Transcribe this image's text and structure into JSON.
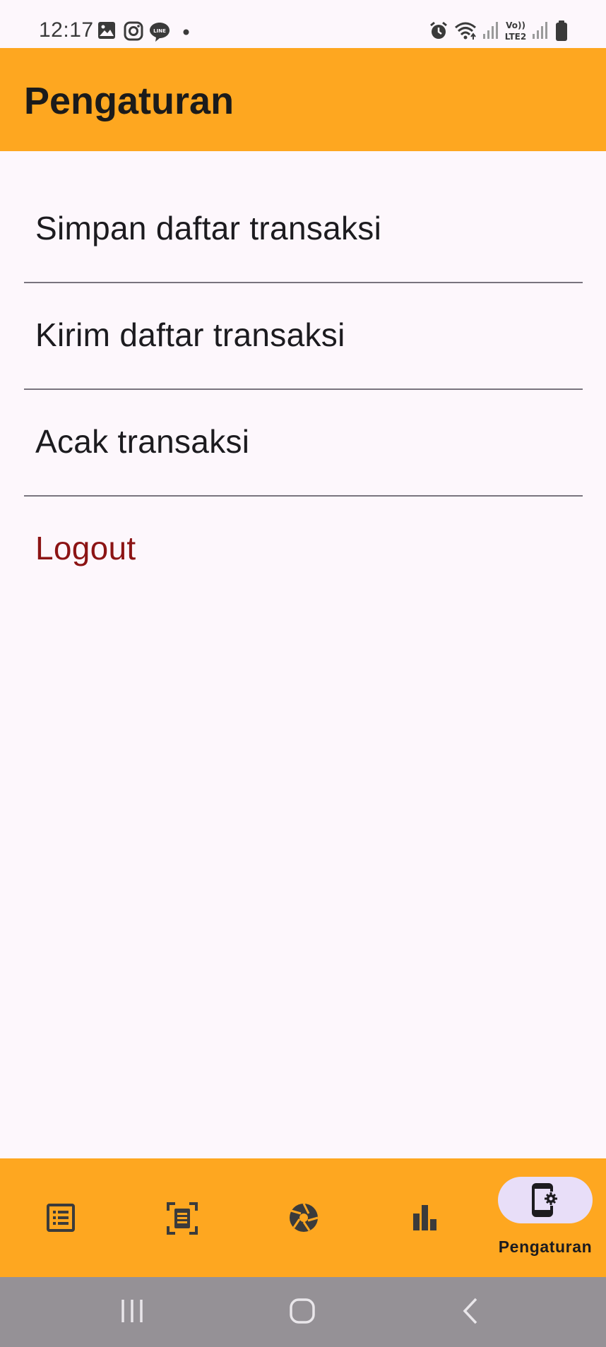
{
  "status_bar": {
    "time": "12:17",
    "left_icons": [
      "gallery-icon",
      "instagram-icon",
      "line-icon",
      "dot-icon"
    ],
    "right_icons": [
      "alarm-icon",
      "wifi-icon",
      "signal-icon",
      "volte-icon",
      "signal-icon",
      "battery-icon"
    ],
    "volte_text": "Vo)) LTE2"
  },
  "app_bar": {
    "title": "Pengaturan",
    "color": "#fea720"
  },
  "settings": {
    "items": [
      {
        "label": "Simpan daftar transaksi"
      },
      {
        "label": "Kirim daftar transaksi"
      },
      {
        "label": "Acak transaksi"
      },
      {
        "label": "Logout",
        "color": "#8c1414"
      }
    ]
  },
  "bottom_nav": {
    "items": [
      {
        "icon": "list-icon"
      },
      {
        "icon": "scan-document-icon"
      },
      {
        "icon": "camera-shutter-icon"
      },
      {
        "icon": "bar-chart-icon"
      },
      {
        "icon": "phone-settings-icon",
        "label": "Pengaturan",
        "selected": true
      }
    ],
    "selected_pill_color": "#e8def8"
  },
  "system_nav": {
    "buttons": [
      "recents-button",
      "home-button",
      "back-button"
    ]
  }
}
